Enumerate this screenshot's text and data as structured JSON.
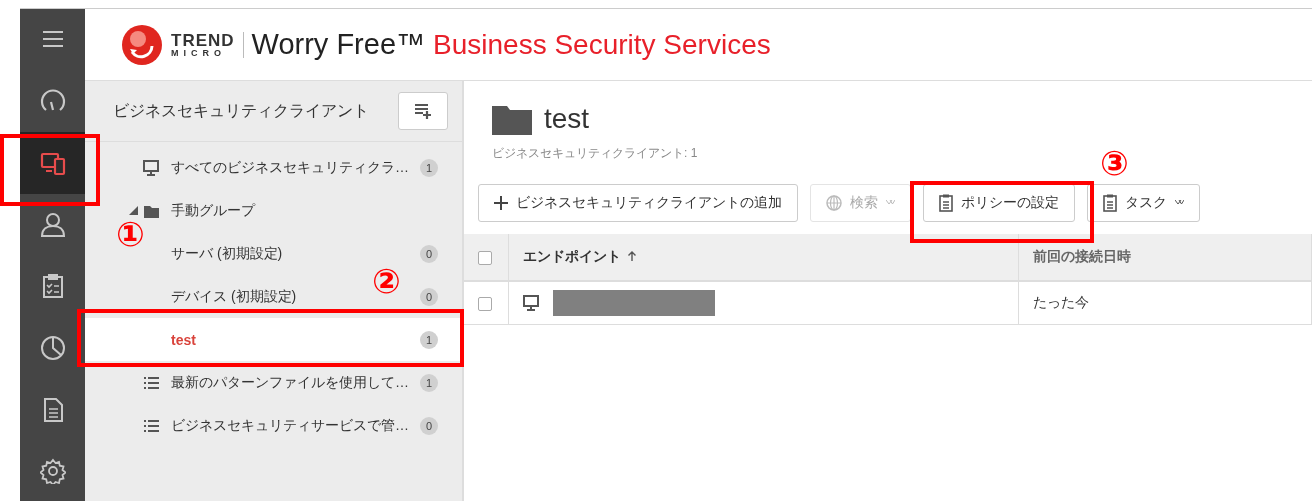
{
  "header": {
    "brand_top": "TREND",
    "brand_bottom": "MICRO",
    "product": "Worry Free™",
    "service": "Business Security Services"
  },
  "rail": [
    {
      "kind": "menu",
      "selected": false
    },
    {
      "kind": "dashboard",
      "selected": false
    },
    {
      "kind": "devices",
      "selected": true
    },
    {
      "kind": "users",
      "selected": false
    },
    {
      "kind": "tasks",
      "selected": false
    },
    {
      "kind": "reports",
      "selected": false
    },
    {
      "kind": "logs",
      "selected": false
    },
    {
      "kind": "settings",
      "selected": false
    }
  ],
  "sidebar": {
    "title": "ビジネスセキュリティクライアント",
    "tree": [
      {
        "kind": "all",
        "label": "すべてのビジネスセキュリティクラ…",
        "count": "1",
        "selected": false
      },
      {
        "kind": "group",
        "label": "手動グループ",
        "expanded": true,
        "selected": false,
        "children": [
          {
            "label": "サーバ (初期設定)",
            "count": "0",
            "selected": false
          },
          {
            "label": "デバイス (初期設定)",
            "count": "0",
            "selected": false
          },
          {
            "label": "test",
            "count": "1",
            "selected": true
          }
        ]
      },
      {
        "kind": "filter",
        "label": "最新のパターンファイルを使用して…",
        "count": "1",
        "selected": false
      },
      {
        "kind": "filter",
        "label": "ビジネスセキュリティサービスで管…",
        "count": "0",
        "selected": false
      }
    ]
  },
  "main": {
    "title": "test",
    "subtitle": "ビジネスセキュリティクライアント: 1",
    "toolbar": [
      {
        "kind": "add",
        "label": "ビジネスセキュリティクライアントの追加",
        "disabled": false,
        "dropdown": false
      },
      {
        "kind": "search",
        "label": "検索",
        "disabled": true,
        "dropdown": true
      },
      {
        "kind": "policy",
        "label": "ポリシーの設定",
        "disabled": false,
        "dropdown": false
      },
      {
        "kind": "task",
        "label": "タスク",
        "disabled": false,
        "dropdown": true
      }
    ],
    "table": {
      "select_all": {
        "checked": false
      },
      "columns": [
        {
          "label": "エンドポイント",
          "sorted_ascending": true
        },
        {
          "label": "前回の接続日時"
        }
      ],
      "rows": [
        {
          "checked": false,
          "endpoint": {
            "redacted": true
          },
          "last_connected": "たった今"
        }
      ]
    }
  },
  "annotations": [
    {
      "label": "①"
    },
    {
      "label": "②"
    },
    {
      "label": "③"
    }
  ]
}
